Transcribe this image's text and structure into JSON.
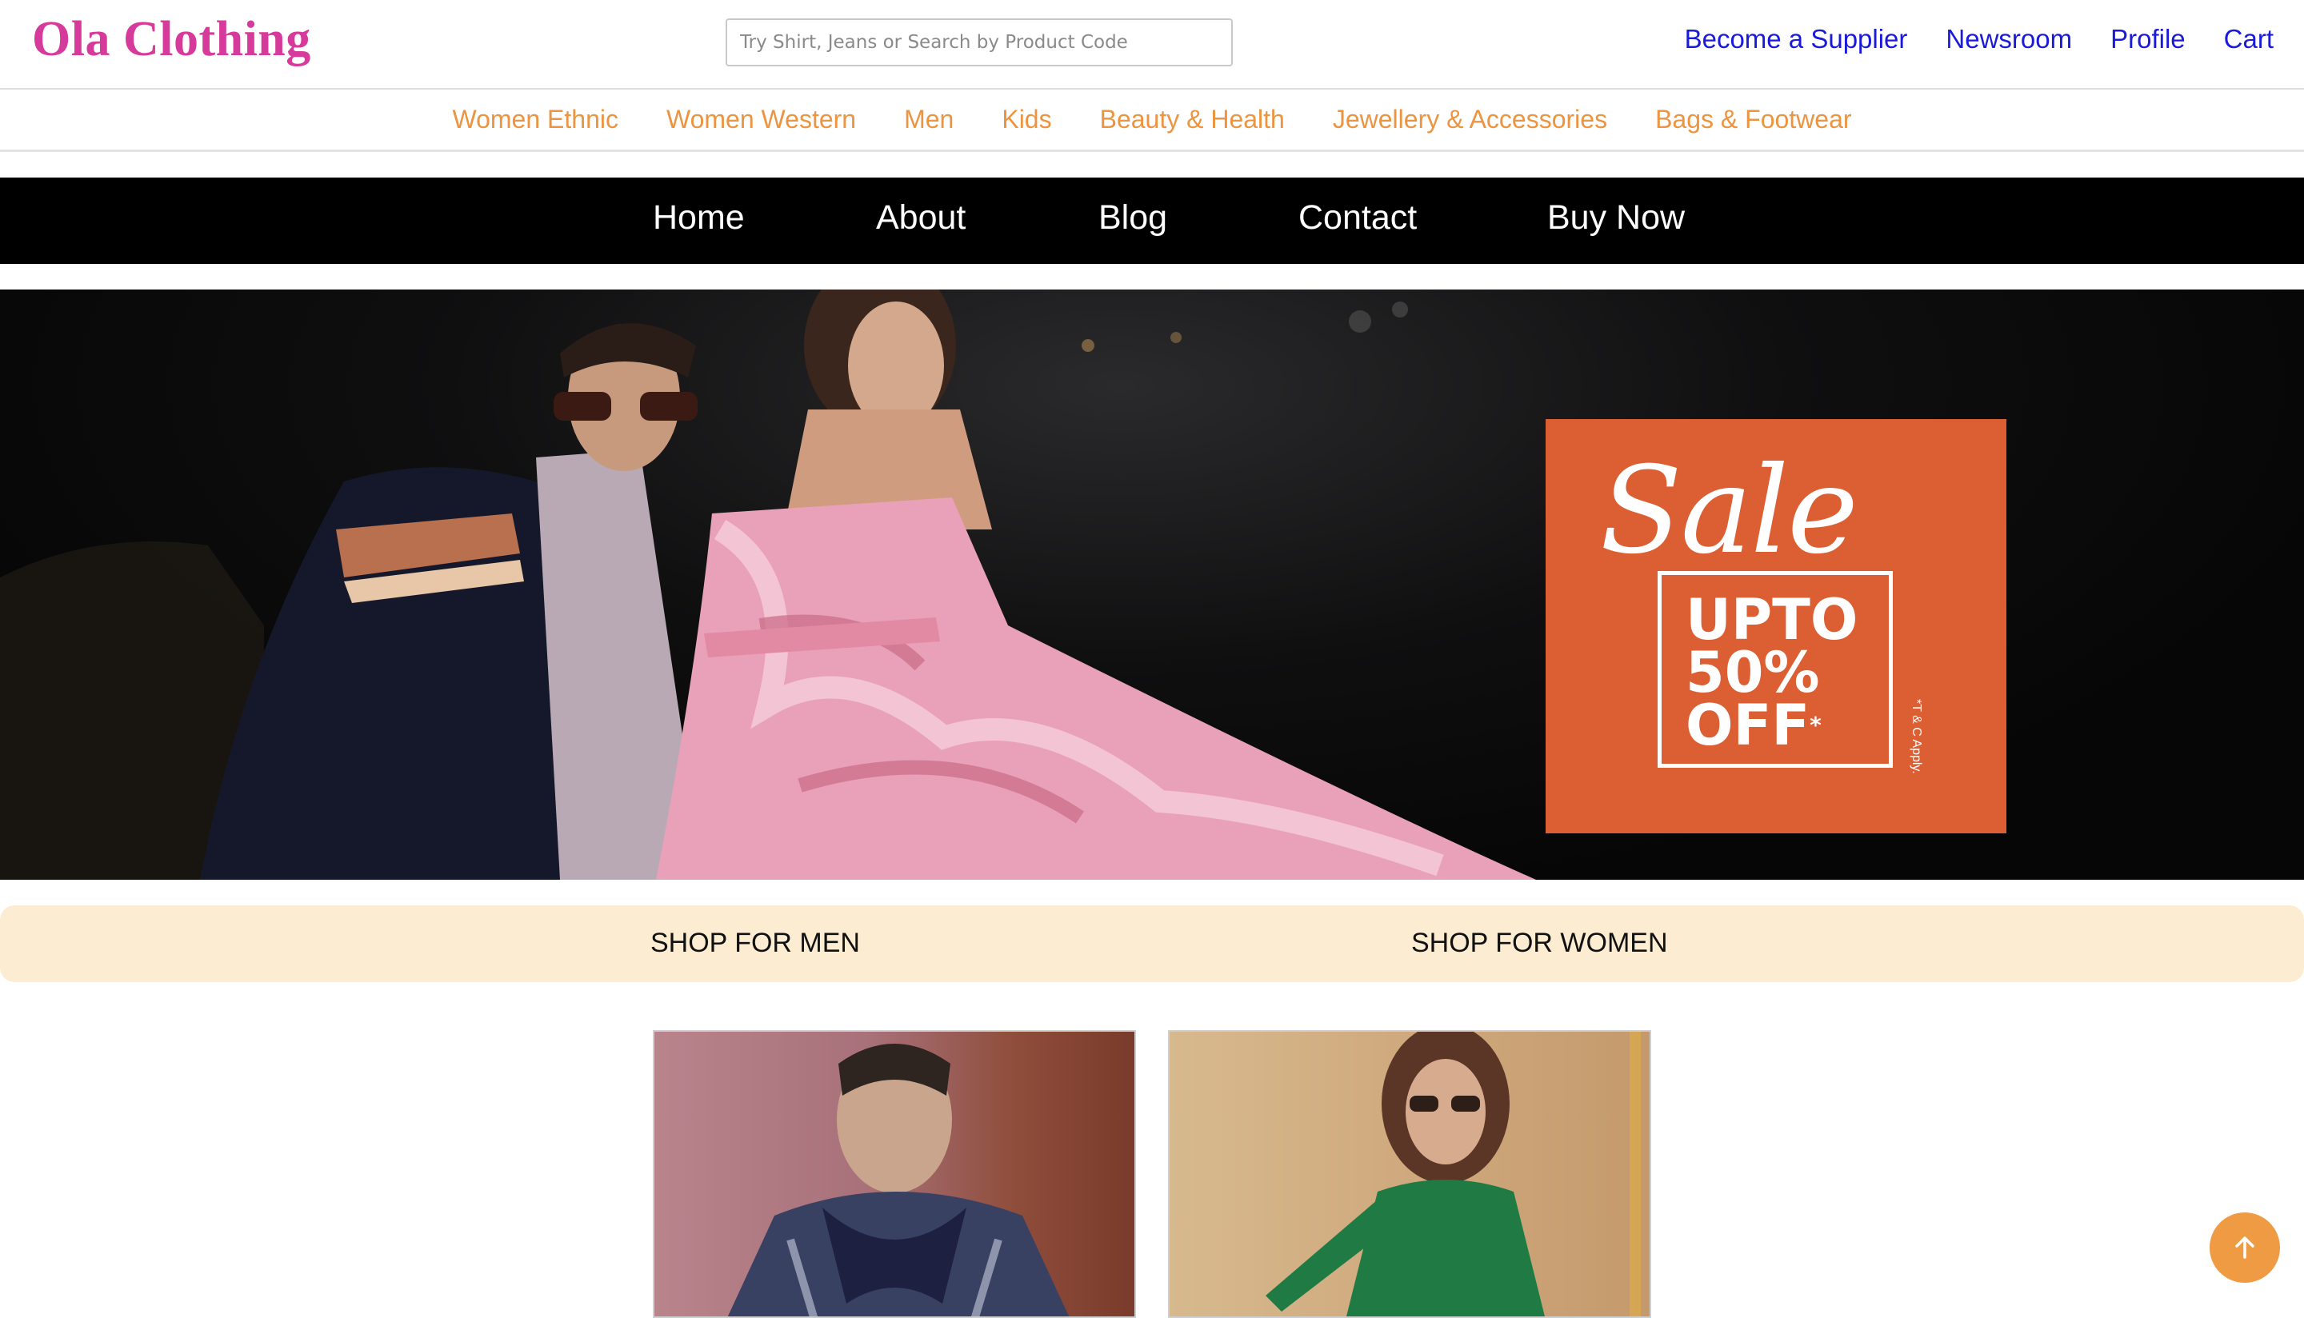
{
  "header": {
    "logo": "Ola Clothing",
    "search_placeholder": "Try Shirt, Jeans or Search by Product Code",
    "links": [
      "Become a Supplier",
      "Newsroom",
      "Profile",
      "Cart"
    ]
  },
  "categories": [
    "Women Ethnic",
    "Women Western",
    "Men",
    "Kids",
    "Beauty & Health",
    "Jewellery & Accessories",
    "Bags & Footwear"
  ],
  "main_nav": [
    "Home",
    "About",
    "Blog",
    "Contact",
    "Buy Now"
  ],
  "hero": {
    "sale_script": "Sale",
    "sale_line1": "UPTO",
    "sale_line2": "50%",
    "sale_line3": "OFF",
    "sale_asterisk": "*",
    "terms": "*T & C Apply."
  },
  "shop_sections": [
    "SHOP FOR MEN",
    "SHOP FOR WOMEN"
  ],
  "colors": {
    "logo": "#d63a9a",
    "top_links": "#1a1adb",
    "category_links": "#ec9440",
    "nav_background": "#000000",
    "sale_box": "#dc5f33",
    "shop_bar": "#fcedd2",
    "back_to_top": "#ef9b43"
  },
  "icons": {
    "back_to_top": "arrow-up-icon"
  }
}
